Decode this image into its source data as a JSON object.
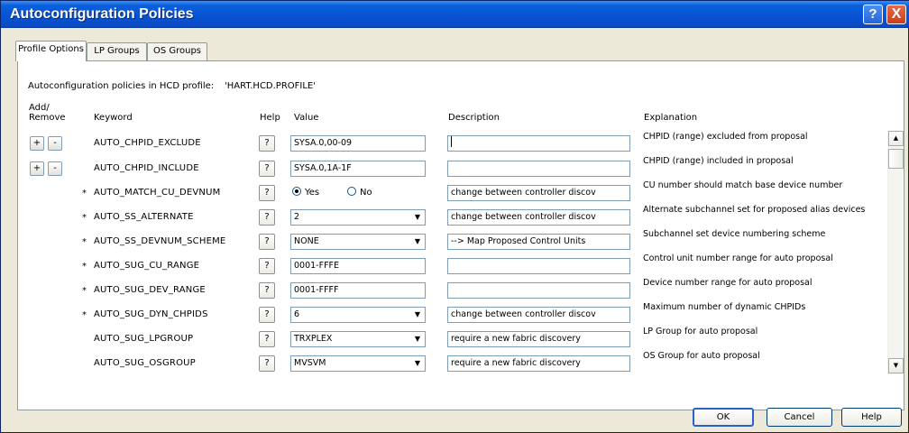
{
  "window": {
    "title": "Autoconfiguration Policies",
    "help_glyph": "?",
    "close_glyph": "X"
  },
  "tabs": [
    {
      "label": "Profile Options",
      "active": true
    },
    {
      "label": "LP Groups",
      "active": false
    },
    {
      "label": "OS Groups",
      "active": false
    }
  ],
  "profile": {
    "label": "Autoconfiguration policies in HCD profile:",
    "value": "'HART.HCD.PROFILE'"
  },
  "headers": {
    "add_remove_line1": "Add/",
    "add_remove_line2": "Remove",
    "keyword": "Keyword",
    "help": "Help",
    "value": "Value",
    "description": "Description",
    "explanation": "Explanation"
  },
  "add_label": "+",
  "remove_label": "-",
  "help_label": "?",
  "rows": [
    {
      "star": "",
      "keyword": "AUTO_CHPID_EXCLUDE",
      "value_type": "text",
      "value": "SYSA.0,00-09",
      "description": "",
      "explanation": "CHPID (range) excluded from proposal",
      "add_remove": true
    },
    {
      "star": "",
      "keyword": "AUTO_CHPID_INCLUDE",
      "value_type": "text",
      "value": "SYSA.0,1A-1F",
      "description": "",
      "explanation": "CHPID (range) included in proposal",
      "add_remove": true
    },
    {
      "star": "*",
      "keyword": "AUTO_MATCH_CU_DEVNUM",
      "value_type": "radio",
      "options": [
        "Yes",
        "No"
      ],
      "selected": "Yes",
      "description": "change between controller discov",
      "explanation": "CU number should match base device number",
      "add_remove": false
    },
    {
      "star": "*",
      "keyword": "AUTO_SS_ALTERNATE",
      "value_type": "combo",
      "value": "2",
      "description": "change between controller discov",
      "explanation": "Alternate subchannel set for proposed alias devices",
      "add_remove": false
    },
    {
      "star": "*",
      "keyword": "AUTO_SS_DEVNUM_SCHEME",
      "value_type": "combo",
      "value": "NONE",
      "description": "--> Map Proposed Control Units",
      "explanation": "Subchannel set device numbering scheme",
      "add_remove": false
    },
    {
      "star": "*",
      "keyword": "AUTO_SUG_CU_RANGE",
      "value_type": "text",
      "value": "0001-FFFE",
      "description": "",
      "explanation": "Control unit number range for auto proposal",
      "add_remove": false
    },
    {
      "star": "*",
      "keyword": "AUTO_SUG_DEV_RANGE",
      "value_type": "text",
      "value": "0001-FFFF",
      "description": "",
      "explanation": "Device number range for auto proposal",
      "add_remove": false
    },
    {
      "star": "*",
      "keyword": "AUTO_SUG_DYN_CHPIDS",
      "value_type": "combo",
      "value": "6",
      "description": "change between controller discov",
      "explanation": "Maximum number of dynamic CHPIDs",
      "add_remove": false
    },
    {
      "star": "",
      "keyword": "AUTO_SUG_LPGROUP",
      "value_type": "combo",
      "value": "TRXPLEX",
      "description": "require a new fabric discovery",
      "explanation": "LP Group for auto proposal",
      "add_remove": false
    },
    {
      "star": "",
      "keyword": "AUTO_SUG_OSGROUP",
      "value_type": "combo",
      "value": "MVSVM",
      "description": "require a new fabric discovery",
      "explanation": "OS Group for auto proposal",
      "add_remove": false
    }
  ],
  "buttons": {
    "ok": "OK",
    "cancel": "Cancel",
    "help": "Help"
  }
}
